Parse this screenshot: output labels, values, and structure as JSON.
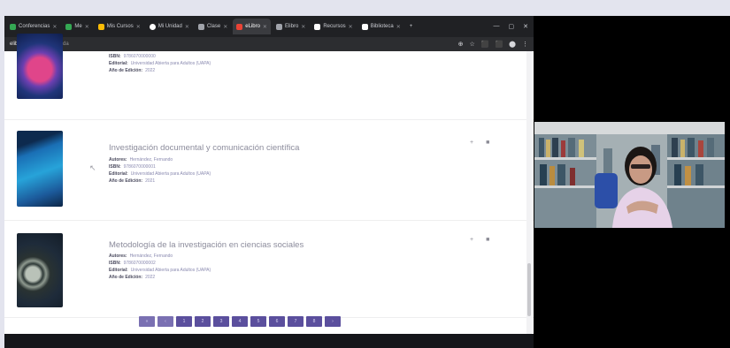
{
  "browser": {
    "tabs": [
      {
        "label": "Conferencias",
        "color": "#34a853"
      },
      {
        "label": "Me",
        "color": "#34a853"
      },
      {
        "label": "Mis Cursos",
        "color": "#fbbc05"
      },
      {
        "label": "Mi Unidad",
        "color": "#ffffff"
      },
      {
        "label": "Clase",
        "color": "#a0a3aa"
      },
      {
        "label": "eLibro",
        "color": "#ea4335",
        "active": true
      },
      {
        "label": "Elibro",
        "color": "#a0a3aa"
      },
      {
        "label": "Recursos",
        "color": "#ffffff"
      },
      {
        "label": "Biblioteca",
        "color": "#ffffff"
      }
    ],
    "new_tab": "+",
    "window_controls": [
      "—",
      "▢",
      "✕"
    ],
    "url_host": "elibro.net",
    "url_path": "/es/lc/busqueda",
    "addr_icons": [
      "⊕",
      "☆",
      "⬛",
      "⬛",
      "⬤",
      "⋮"
    ]
  },
  "books": [
    {
      "title": "",
      "meta": [
        {
          "key": "ISBN:",
          "value": "9786070000000"
        },
        {
          "key": "Editorial:",
          "value": "Universidad Abierta para Adultos (UAPA)"
        },
        {
          "key": "Año de Edición:",
          "value": "2022"
        }
      ]
    },
    {
      "title": "Investigación documental y comunicación científica",
      "meta": [
        {
          "key": "Autores:",
          "value": "Hernández, Fernando"
        },
        {
          "key": "ISBN:",
          "value": "9786070000001"
        },
        {
          "key": "Editorial:",
          "value": "Universidad Abierta para Adultos (UAPA)"
        },
        {
          "key": "Año de Edición:",
          "value": "2021"
        }
      ]
    },
    {
      "title": "Metodología de la investigación en ciencias sociales",
      "meta": [
        {
          "key": "Autores:",
          "value": "Hernández, Fernando"
        },
        {
          "key": "ISBN:",
          "value": "9786070000002"
        },
        {
          "key": "Editorial:",
          "value": "Universidad Abierta para Adultos (UAPA)"
        },
        {
          "key": "Año de Edición:",
          "value": "2022"
        }
      ]
    }
  ],
  "book_actions": {
    "add": "+",
    "bookmark": "■"
  },
  "pagination": [
    "«",
    "‹",
    "1",
    "2",
    "3",
    "4",
    "5",
    "6",
    "7",
    "8",
    "›"
  ],
  "colors": {
    "accent": "#5b4f9d",
    "title_text": "#8c8c9c",
    "dark_chrome": "#202124"
  }
}
